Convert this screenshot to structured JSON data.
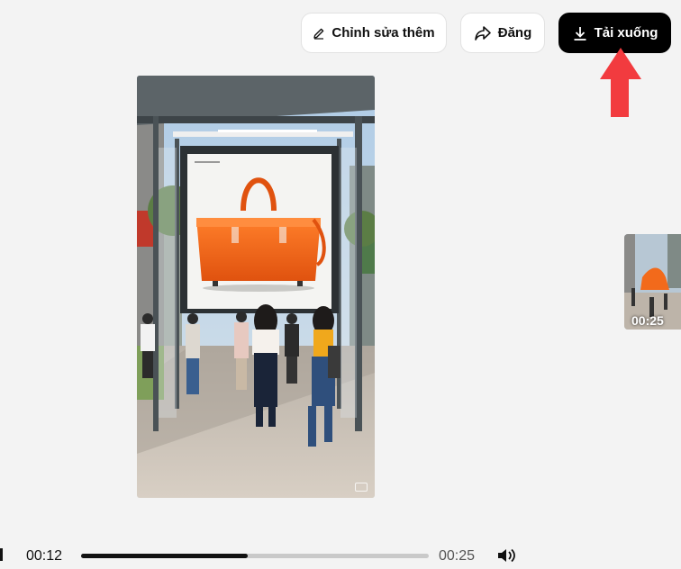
{
  "toolbar": {
    "edit_label": "Chỉnh sửa thêm",
    "edit_icon": "pencil-icon",
    "share_label": "Đăng",
    "share_icon": "share-arrow-icon",
    "download_label": "Tải xuống",
    "download_icon": "download-icon"
  },
  "annotation": {
    "icon": "red-arrow-up-icon",
    "color": "#f23b3f"
  },
  "video": {
    "subject": "orange handbag billboard at bus stop",
    "accent_color": "#f26a1b"
  },
  "side_thumbnail": {
    "duration": "00:25"
  },
  "player": {
    "current_time": "00:12",
    "total_time": "00:25",
    "progress_fraction": 0.48,
    "volume_icon": "speaker-icon"
  }
}
